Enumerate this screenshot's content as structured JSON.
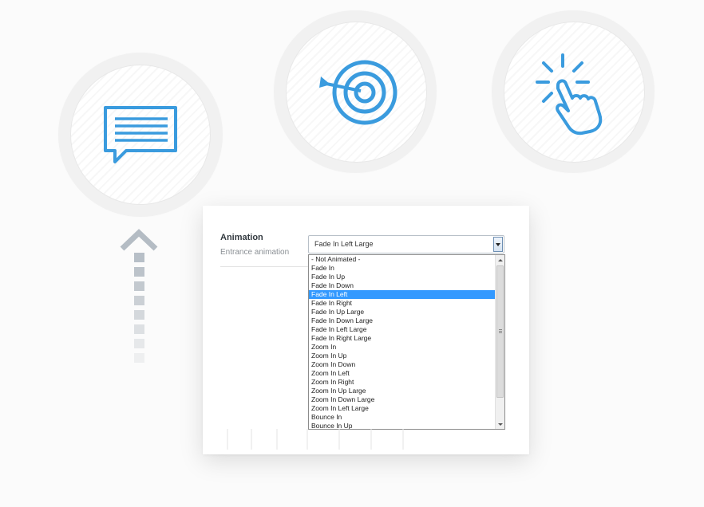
{
  "icons": {
    "chat": "chat-bubble-icon",
    "target": "target-icon",
    "click": "click-hand-icon",
    "arrow": "dotted-up-arrow-icon"
  },
  "colors": {
    "icon_blue": "#3a9bde",
    "arrow_gray": "#b4bcc4",
    "selected_bg": "#3399ff"
  },
  "animation_field": {
    "title": "Animation",
    "description": "Entrance animation",
    "selected_value": "Fade In Left Large",
    "options": [
      "- Not Animated -",
      "Fade In",
      "Fade In Up",
      "Fade In Down",
      "Fade In Left",
      "Fade In Right",
      "Fade In Up Large",
      "Fade In Down Large",
      "Fade In Left Large",
      "Fade In Right Large",
      "Zoom In",
      "Zoom In Up",
      "Zoom In Down",
      "Zoom In Left",
      "Zoom In Right",
      "Zoom In Up Large",
      "Zoom In Down Large",
      "Zoom In Left Large",
      "Bounce In",
      "Bounce In Up"
    ],
    "highlighted_option": "Fade In Left"
  }
}
